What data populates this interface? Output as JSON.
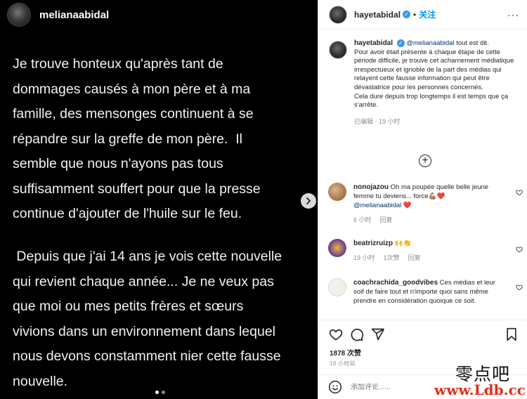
{
  "story": {
    "username": "melianaabidal",
    "paragraph1": "Je trouve honteux qu'après tant de\ndommages causés à mon père et à ma\nfamille, des mensonges continuent à se\nrépandre sur la greffe de mon père.  Il\nsemble que nous n'ayons pas tous\nsuffisamment souffert pour que la presse\ncontinue d'ajouter de l'huile sur le feu.",
    "paragraph2": " Depuis que j'ai 14 ans je vois cette nouvelle\nqui revient chaque année... Je ne veux pas\nque moi ou mes petits frères et sœurs\nvivions dans un environnement dans lequel\nnous devons constamment nier cette fausse\nnouvelle.",
    "next_icon": "chevron-right-icon"
  },
  "header": {
    "username": "hayetabidal",
    "verified_icon": "verified-badge-icon",
    "separator": "•",
    "follow_label": "关注",
    "more_label": "···"
  },
  "caption": {
    "username": "hayetabidal",
    "mention": "@melianaabidal",
    "text_after_mention": " tout est dit.",
    "body": "Pour avoir était présente à chaque étape de cette période difficile, je trouve cet acharnement médiatique irrespectueux et ignoble de la part des médias qui relayent cette fausse information qui peut être dévastatrice pour les personnes concernés.\nCela dure depuis trop longtemps il est temps que ça s'arrête.",
    "meta": "已编辑 · 19 小时"
  },
  "load_more_label": "+",
  "comments": [
    {
      "username": "nonojazou",
      "text": " Oh ma poupée quelle belle jeune femme tu deviens... force💪🏽❤️",
      "mention": "@melianaabidal",
      "after": " ❤️",
      "time": "6 小时",
      "reply": "回复",
      "likes": ""
    },
    {
      "username": "beatrizruizp",
      "text": " 🙌👏",
      "mention": "",
      "after": "",
      "time": "19 小时",
      "likes": "1次赞",
      "reply": "回复"
    },
    {
      "username": "coachrachida_goodvibes",
      "text": " Ces médias et leur soif de faire tout et n'importe quoi sans même prendre en considération quoique ce soit.",
      "mention": "",
      "after": "",
      "time": "",
      "likes": "",
      "reply": ""
    }
  ],
  "actions": {
    "like_icon": "heart-icon",
    "comment_icon": "comment-icon",
    "share_icon": "share-icon",
    "save_icon": "bookmark-icon"
  },
  "likes_count": "1878 次赞",
  "timestamp": "19 小时前",
  "add_comment": {
    "placeholder": "添加评论......",
    "emoji_icon": "smiley-icon"
  },
  "watermark": {
    "cn": "零点吧",
    "url": "www.Ldb.cc"
  },
  "colors": {
    "accent": "#0095f6",
    "heart": "#ed4956",
    "story_bg": "#000000"
  }
}
